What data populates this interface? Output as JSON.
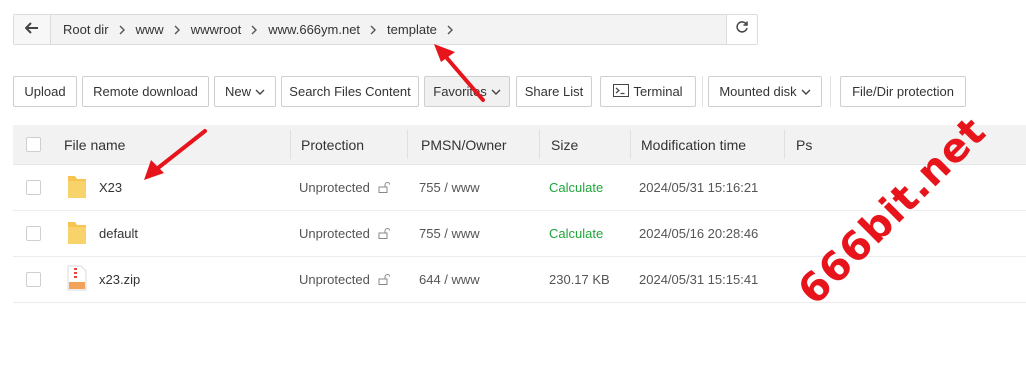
{
  "breadcrumb": {
    "items": [
      "Root dir",
      "www",
      "wwwroot",
      "www.666ym.net",
      "template"
    ]
  },
  "toolbar": {
    "upload": "Upload",
    "remote_download": "Remote download",
    "new": "New",
    "search_files": "Search Files Content",
    "favorites": "Favorites",
    "share_list": "Share List",
    "terminal": "Terminal",
    "mounted_disk": "Mounted disk",
    "protection": "File/Dir protection"
  },
  "table": {
    "headers": {
      "name": "File name",
      "protection": "Protection",
      "pmsn": "PMSN/Owner",
      "size": "Size",
      "mtime": "Modification time",
      "ps": "Ps"
    },
    "rows": [
      {
        "name": "X23",
        "type": "folder",
        "protection": "Unprotected",
        "pmsn": "755 / www",
        "size": "Calculate",
        "mtime": "2024/05/31 15:16:21"
      },
      {
        "name": "default",
        "type": "folder",
        "protection": "Unprotected",
        "pmsn": "755 / www",
        "size": "Calculate",
        "mtime": "2024/05/16 20:28:46"
      },
      {
        "name": "x23.zip",
        "type": "zip",
        "protection": "Unprotected",
        "pmsn": "644 / www",
        "size": "230.17 KB",
        "mtime": "2024/05/31 15:15:41"
      }
    ]
  },
  "watermark": "666bit.net",
  "icons": {
    "back": "arrow-left-icon",
    "refresh": "refresh-icon",
    "terminal": "terminal-icon",
    "folder": "folder-icon",
    "zip": "zip-file-icon",
    "lock": "lock-icon"
  },
  "colors": {
    "accent_green": "#20a53a",
    "annotation_red": "#e8141c",
    "folder": "#f5c451"
  }
}
